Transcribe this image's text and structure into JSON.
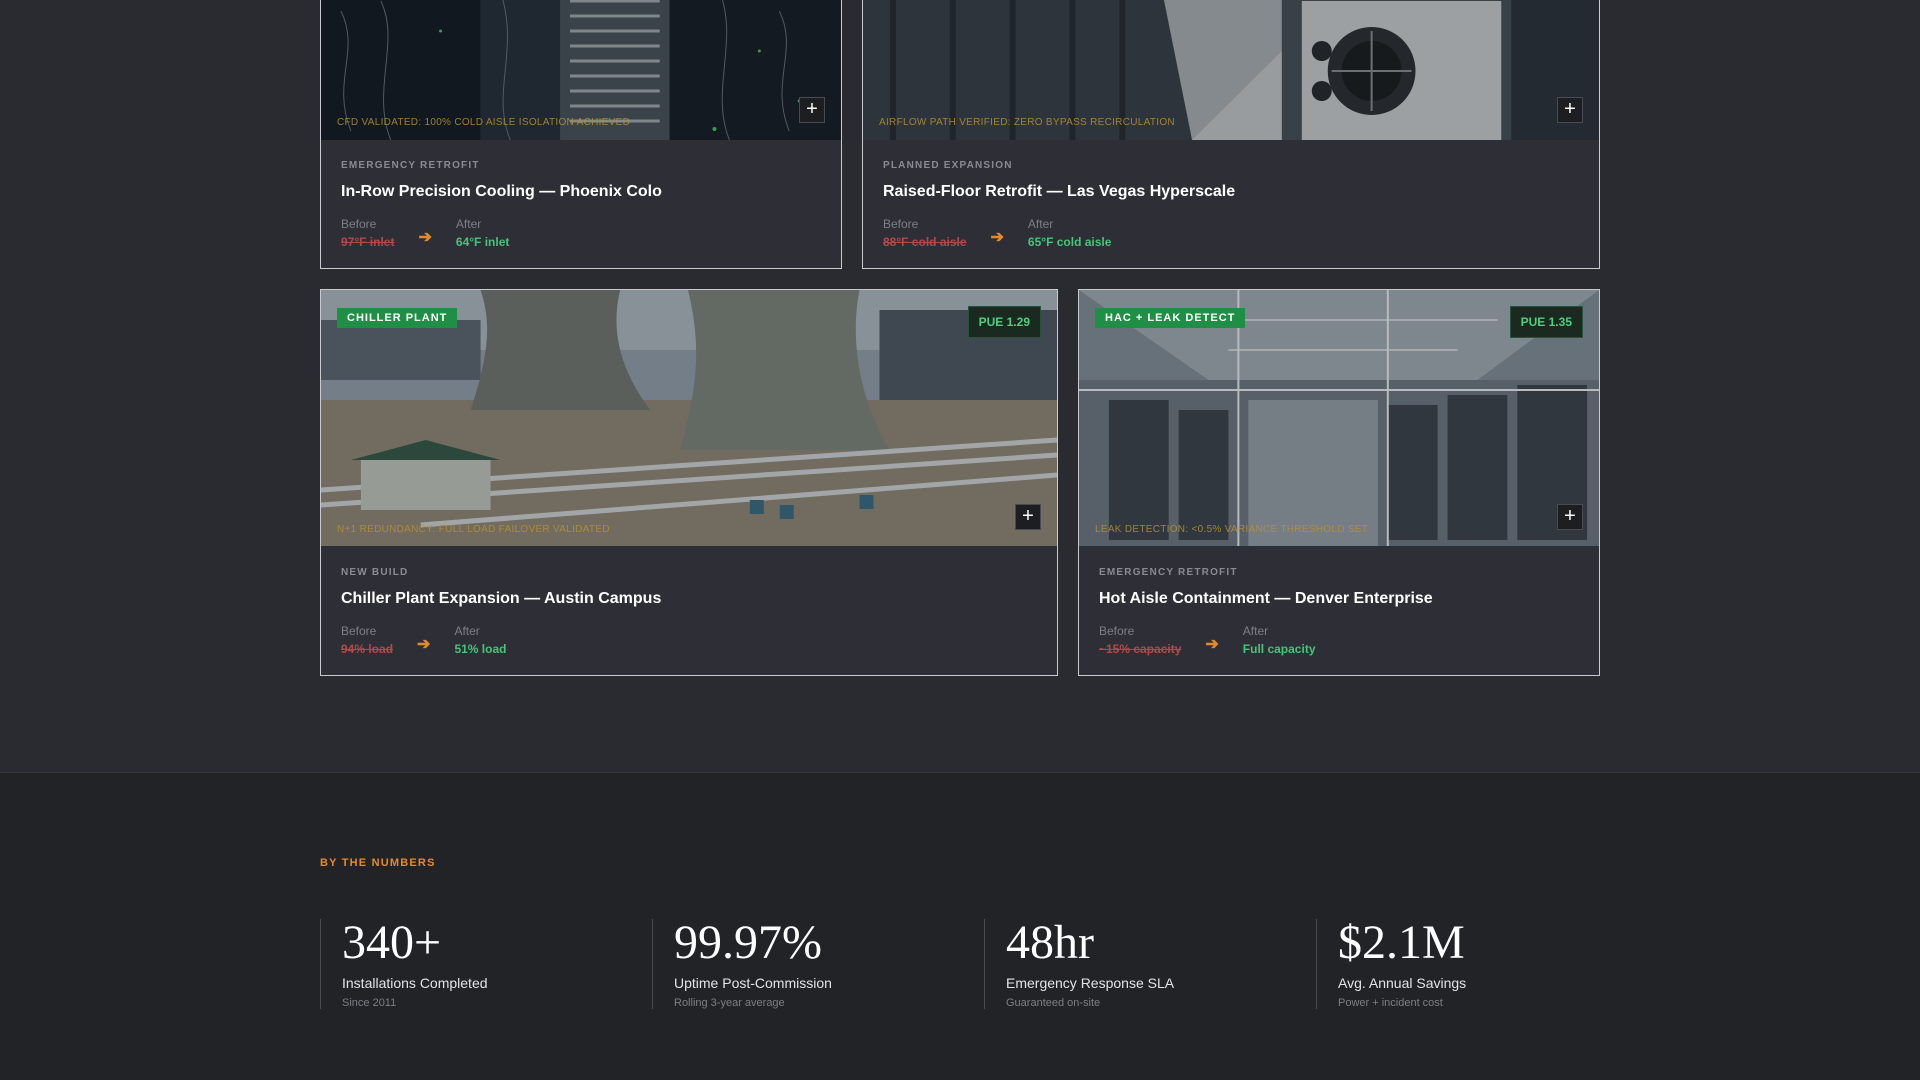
{
  "projects": [
    {
      "caption": "CFD VALIDATED: 100% COLD AISLE ISOLATION ACHIEVED",
      "plus_label": "+",
      "kicker": "EMERGENCY RETROFIT",
      "title": "In-Row Precision Cooling — Phoenix Colo",
      "before_label": "Before",
      "before_value": "97°F inlet",
      "after_label": "After",
      "after_value": "64°F inlet",
      "arrow": "➔"
    },
    {
      "caption": "AIRFLOW PATH VERIFIED: ZERO BYPASS RECIRCULATION",
      "plus_label": "+",
      "kicker": "PLANNED EXPANSION",
      "title": "Raised-Floor Retrofit — Las Vegas Hyperscale",
      "before_label": "Before",
      "before_value": "88°F cold aisle",
      "after_label": "After",
      "after_value": "65°F cold aisle",
      "arrow": "➔"
    },
    {
      "badge": "CHILLER PLANT",
      "pue": "PUE 1.29",
      "caption": "N+1 REDUNDANCY: FULL LOAD FAILOVER VALIDATED",
      "plus_label": "+",
      "kicker": "NEW BUILD",
      "title": "Chiller Plant Expansion — Austin Campus",
      "before_label": "Before",
      "before_value": "94% load",
      "after_label": "After",
      "after_value": "51% load",
      "arrow": "➔"
    },
    {
      "badge": "HAC + LEAK DETECT",
      "pue": "PUE 1.35",
      "caption": "LEAK DETECTION: <0.5% VARIANCE THRESHOLD SET",
      "plus_label": "+",
      "kicker": "EMERGENCY RETROFIT",
      "title": "Hot Aisle Containment — Denver Enterprise",
      "before_label": "Before",
      "before_value": "~15% capacity",
      "after_label": "After",
      "after_value": "Full capacity",
      "arrow": "➔"
    }
  ],
  "numbers": {
    "eyebrow": "BY THE NUMBERS",
    "stats": [
      {
        "value": "340+",
        "label": "Installations Completed",
        "sub": "Since 2011"
      },
      {
        "value": "99.97%",
        "label": "Uptime Post-Commission",
        "sub": "Rolling 3-year average"
      },
      {
        "value": "48hr",
        "label": "Emergency Response SLA",
        "sub": "Guaranteed on-site"
      },
      {
        "value": "$2.1M",
        "label": "Avg. Annual Savings",
        "sub": "Power + incident cost"
      }
    ]
  },
  "colors": {
    "accent_orange": "#e58a2a",
    "success_green": "#46c477",
    "danger_red": "#b04a4a",
    "badge_green": "#1f8f45"
  }
}
